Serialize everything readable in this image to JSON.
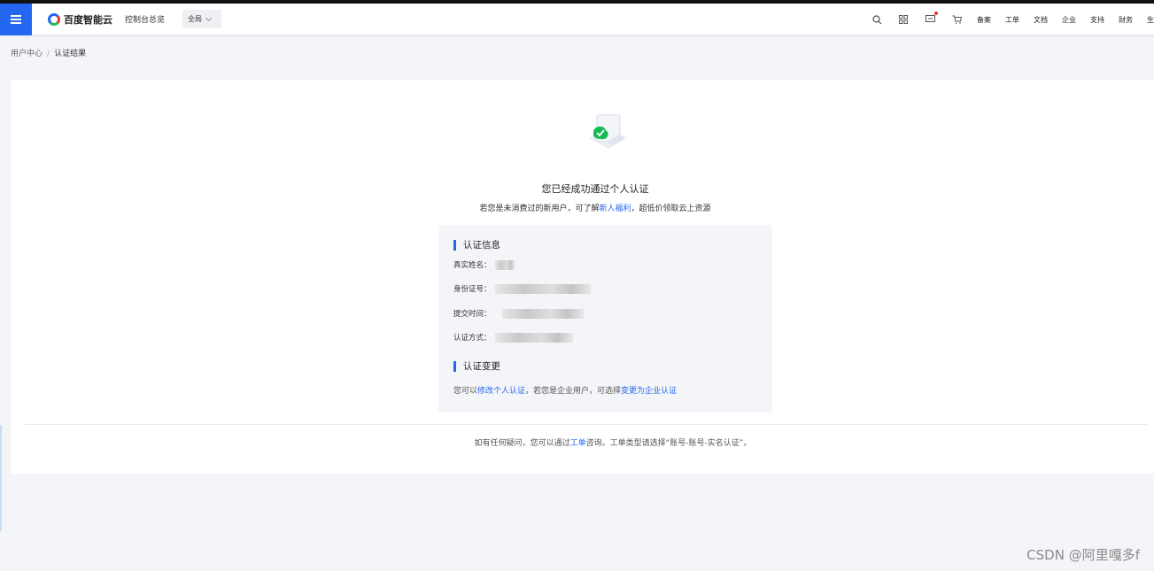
{
  "header": {
    "logo": "百度智能云",
    "console": "控制台总览",
    "region": "全局",
    "nav": [
      "备案",
      "工单",
      "文档",
      "企业",
      "支持",
      "财务",
      "生"
    ]
  },
  "breadcrumb": {
    "parent": "用户中心",
    "sep": "/",
    "current": "认证结果"
  },
  "result": {
    "title": "您已经成功通过个人认证",
    "sub_prefix": "若您是未消费过的新用户，可了解",
    "sub_link": "新人福利",
    "sub_suffix": "，超低价领取云上资源"
  },
  "info": {
    "title": "认证信息",
    "fields": [
      {
        "label": "真实姓名："
      },
      {
        "label": "身份证号："
      },
      {
        "label": "提交时间："
      },
      {
        "label": "认证方式："
      }
    ]
  },
  "change": {
    "title": "认证变更",
    "prefix": "您可以",
    "link1": "修改个人认证",
    "middle": "，若您是企业用户，可选择",
    "link2": "变更为企业认证"
  },
  "footer": {
    "prefix": "如有任何疑问，您可以通过",
    "link": "工单",
    "suffix": "咨询。工单类型请选择“账号-账号-实名认证”。"
  },
  "watermark": "CSDN @阿里嘎多f",
  "colors": {
    "brand": "#2468f2",
    "success": "#19b955"
  }
}
